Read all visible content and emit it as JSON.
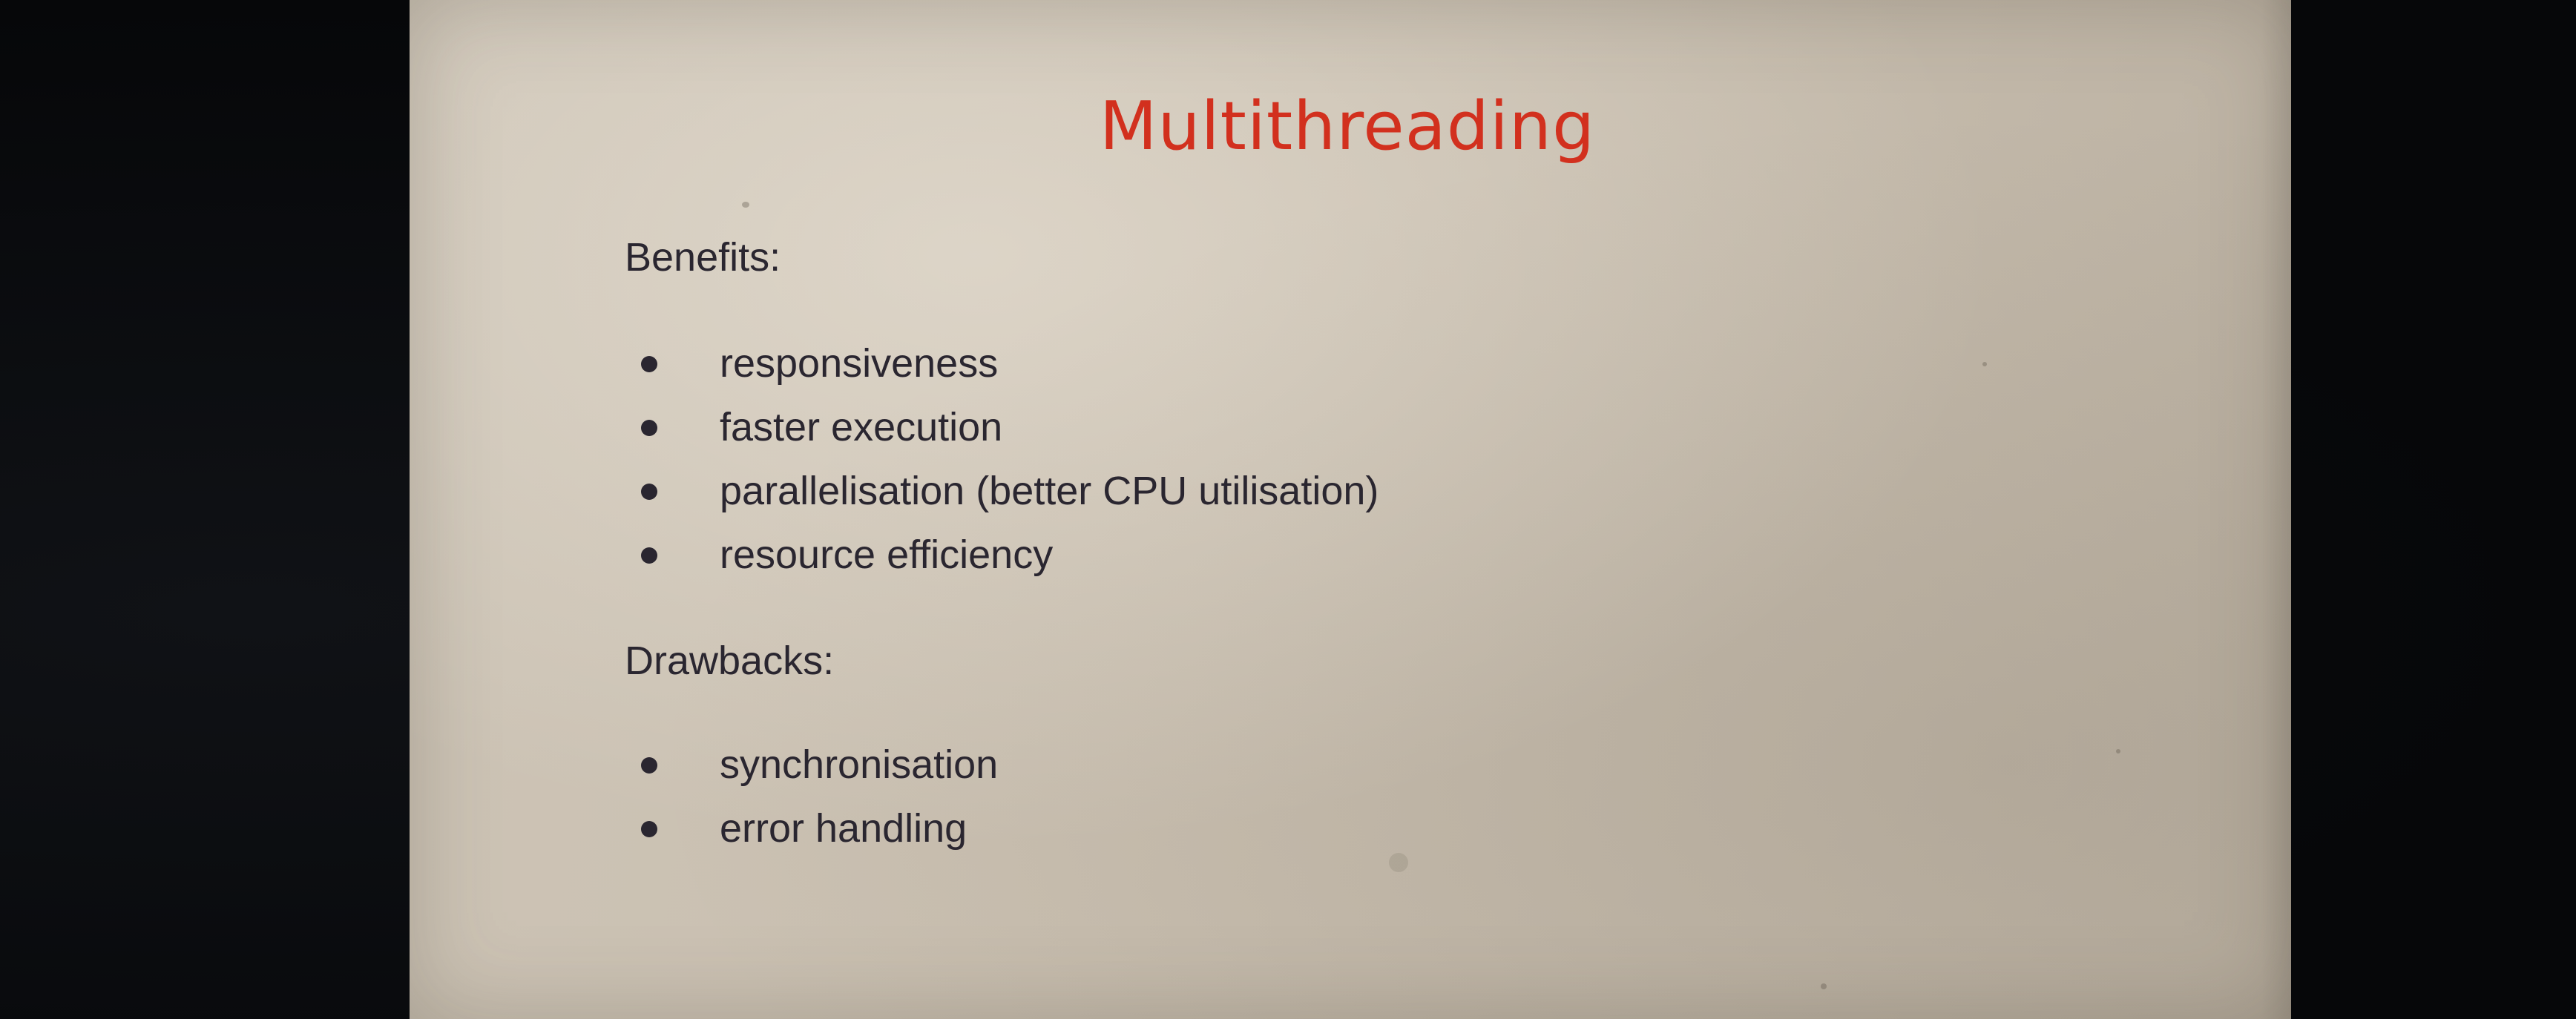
{
  "slide": {
    "title": "Multithreading",
    "benefits": {
      "heading": "Benefits:",
      "items": [
        "responsiveness",
        "faster execution",
        "parallelisation (better CPU utilisation)",
        "resource efficiency"
      ]
    },
    "drawbacks": {
      "heading": "Drawbacks:",
      "items": [
        "synchronisation",
        "error handling"
      ]
    }
  },
  "colors": {
    "title": "#d2301e",
    "body_text": "#2a2630",
    "slide_background": "#c9bfb0",
    "surround": "#07080a"
  }
}
